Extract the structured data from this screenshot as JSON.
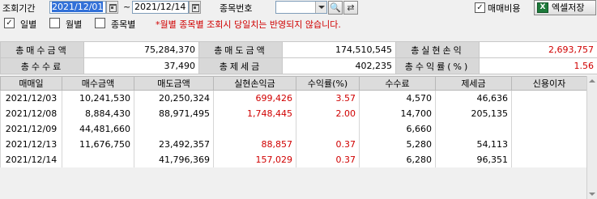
{
  "toolbar": {
    "period_label": "조회기간",
    "date_from": "2021/12/01",
    "tilde": "~",
    "date_to": "2021/12/14",
    "stock_code_label": "종목번호",
    "stock_code_value": "",
    "margin_label": "매매비용",
    "margin_checked": true,
    "excel_label": "엑셀저장",
    "excel_icon_text": "X"
  },
  "options": {
    "daily_label": "일별",
    "daily_checked": true,
    "monthly_label": "월별",
    "monthly_checked": false,
    "by_stock_label": "종목별",
    "by_stock_checked": false,
    "notice": "*월별 종목별 조회시 당일치는 반영되지 않습니다."
  },
  "summary": {
    "row1": [
      {
        "label": "총매수금액",
        "value": "75,284,370"
      },
      {
        "label": "총매도금액",
        "value": "174,510,545"
      },
      {
        "label": "총실현손익",
        "value": "2,693,757"
      }
    ],
    "row2": [
      {
        "label": "총수수료",
        "value": "37,490"
      },
      {
        "label": "총제세금",
        "value": "402,235"
      },
      {
        "label": "총수익률(%)",
        "value": "1.56"
      }
    ]
  },
  "grid": {
    "columns": [
      "매매일",
      "매수금액",
      "매도금액",
      "실현손익금",
      "수익률(%)",
      "수수료",
      "제세금",
      "신용이자"
    ],
    "rows": [
      [
        "2021/12/03",
        "10,241,530",
        "20,250,324",
        "699,426",
        "3.57",
        "4,570",
        "46,636",
        ""
      ],
      [
        "2021/12/08",
        "8,884,430",
        "88,971,495",
        "1,748,445",
        "2.00",
        "14,700",
        "205,135",
        ""
      ],
      [
        "2021/12/09",
        "44,481,660",
        "",
        "",
        "",
        "6,660",
        "",
        ""
      ],
      [
        "2021/12/13",
        "11,676,750",
        "23,492,357",
        "88,857",
        "0.37",
        "5,280",
        "54,113",
        ""
      ],
      [
        "2021/12/14",
        "",
        "41,796,369",
        "157,029",
        "0.37",
        "6,280",
        "96,351",
        ""
      ]
    ]
  },
  "colors": {
    "profit": "#d00000",
    "selected_date_bg": "#3170d8"
  }
}
